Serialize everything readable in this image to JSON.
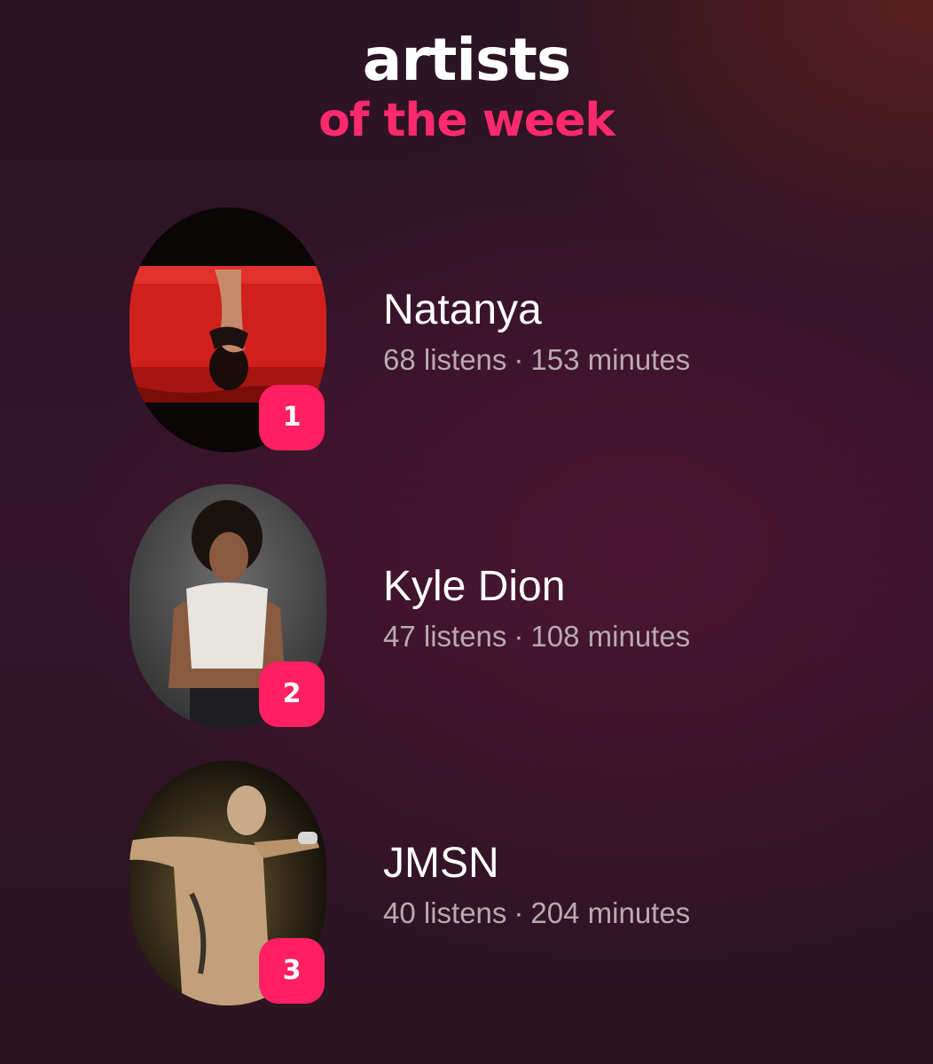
{
  "header": {
    "line1": "artists",
    "line2": "of the week"
  },
  "colors": {
    "accent": "#ff1f62",
    "title_pink": "#ff2a6d",
    "stats_text": "#b9a9b2"
  },
  "artists": [
    {
      "rank": "1",
      "name": "Natanya",
      "listens": "68 listens",
      "separator": "·",
      "minutes": "153 minutes"
    },
    {
      "rank": "2",
      "name": "Kyle Dion",
      "listens": "47 listens",
      "separator": "·",
      "minutes": "108 minutes"
    },
    {
      "rank": "3",
      "name": "JMSN",
      "listens": "40 listens",
      "separator": "·",
      "minutes": "204 minutes"
    }
  ]
}
